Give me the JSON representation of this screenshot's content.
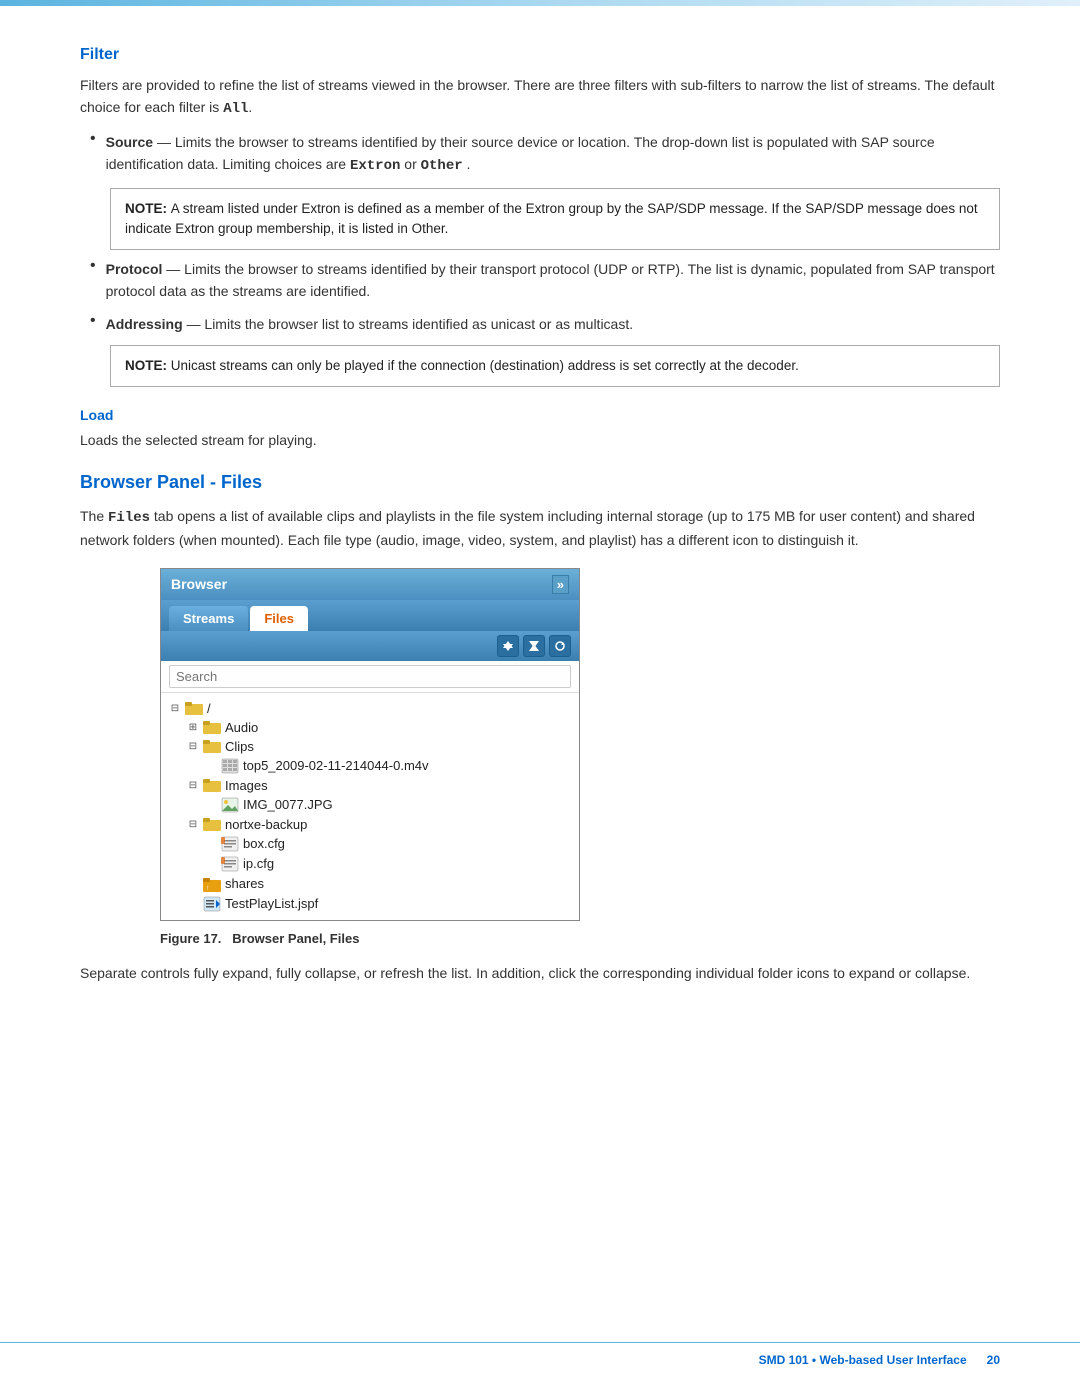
{
  "topBar": {
    "visible": true
  },
  "filter": {
    "heading": "Filter",
    "intro": "Filters are provided to refine the list of streams viewed in the browser. There are three filters with sub-filters to narrow the list of streams. The default choice for each filter is",
    "introCode": "All",
    "introPeriod": ".",
    "bullets": [
      {
        "label": "Source",
        "dash": "—",
        "text": "Limits the browser to streams identified by their source device or location. The drop-down list is populated with SAP source identification data. Limiting choices are",
        "code1": "Extron",
        "or": "or",
        "code2": "Other",
        "period": "."
      },
      {
        "label": "Protocol",
        "dash": "—",
        "text": "Limits the browser to streams identified by their transport protocol (UDP or RTP). The list is dynamic, populated from SAP transport protocol data as the streams are identified."
      },
      {
        "label": "Addressing",
        "dash": "—",
        "text": "Limits the browser list to streams identified as unicast or as multicast."
      }
    ],
    "note1": {
      "label": "NOTE:",
      "text": "A stream listed under Extron is defined as a member of the Extron group by the SAP/SDP message. If the SAP/SDP message does not indicate Extron group membership, it is listed in Other."
    },
    "note2": {
      "label": "NOTE:",
      "text": "Unicast streams can only be played if the connection (destination) address is set correctly at the decoder."
    }
  },
  "load": {
    "heading": "Load",
    "text": "Loads the selected stream for playing."
  },
  "browserPanelFiles": {
    "heading": "Browser Panel - Files",
    "intro1": "The",
    "filesCode": "Files",
    "intro2": "tab opens a list of available clips and playlists in the file system including internal storage (up to 175 MB for user content) and shared network folders (when mounted). Each file type (audio, image, video, system, and playlist) has a different icon to distinguish it.",
    "browser": {
      "title": "Browser",
      "expandIcon": "»",
      "tabs": [
        {
          "label": "Streams",
          "active": false
        },
        {
          "label": "Files",
          "active": true
        }
      ],
      "toolbarIcons": [
        "▲",
        "▼",
        "✕"
      ],
      "searchPlaceholder": "Search",
      "fileTree": [
        {
          "level": 0,
          "expand": "⊟",
          "icon": "folder",
          "label": "/"
        },
        {
          "level": 1,
          "expand": "⊞",
          "icon": "folder",
          "label": "Audio"
        },
        {
          "level": 1,
          "expand": "⊟",
          "icon": "folder",
          "label": "Clips"
        },
        {
          "level": 2,
          "expand": "",
          "icon": "video",
          "label": "top5_2009-02-11-214044-0.m4v"
        },
        {
          "level": 1,
          "expand": "⊟",
          "icon": "folder",
          "label": "Images"
        },
        {
          "level": 2,
          "expand": "",
          "icon": "image",
          "label": "IMG_0077.JPG"
        },
        {
          "level": 1,
          "expand": "⊟",
          "icon": "folder",
          "label": "nortxe-backup"
        },
        {
          "level": 2,
          "expand": "",
          "icon": "system",
          "label": "box.cfg"
        },
        {
          "level": 2,
          "expand": "",
          "icon": "system",
          "label": "ip.cfg"
        },
        {
          "level": 1,
          "expand": "",
          "icon": "folder-special",
          "label": "shares"
        },
        {
          "level": 1,
          "expand": "",
          "icon": "playlist",
          "label": "TestPlayList.jspf"
        }
      ]
    },
    "figureCaption": {
      "prefix": "Figure 17.",
      "label": "Browser Panel, Files"
    },
    "afterText": "Separate controls fully expand, fully collapse, or refresh the list. In addition, click the corresponding individual folder icons to expand or collapse."
  },
  "footer": {
    "product": "SMD 101 • Web-based User Interface",
    "pageNumber": "20"
  }
}
